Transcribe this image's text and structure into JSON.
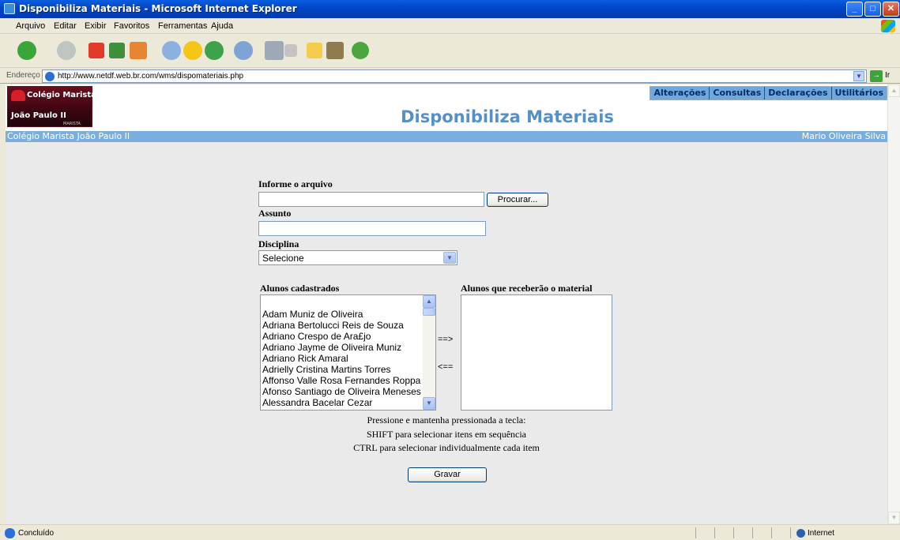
{
  "window": {
    "title": "Disponibiliza Materiais - Microsoft Internet Explorer",
    "minimize": "_",
    "maximize": "□",
    "close": "✕"
  },
  "menu": [
    "Arquivo",
    "Editar",
    "Exibir",
    "Favoritos",
    "Ferramentas",
    "Ajuda"
  ],
  "toolbar_icons": [
    "back-icon",
    "forward-icon",
    "stop-icon",
    "refresh-icon",
    "home-icon",
    "search-icon",
    "favorites-icon",
    "history-icon",
    "mail-icon",
    "print-icon",
    "edit-icon",
    "discuss-icon",
    "research-icon",
    "messenger-icon"
  ],
  "address": {
    "label": "Endereço",
    "url": "http://www.netdf.web.br.com/wms/dispomateriais.php",
    "go_label": "Ir"
  },
  "header": {
    "logo_line1": "Colégio Marista",
    "logo_line2": "João Paulo II",
    "logo_line3": "MARISTA",
    "page_title": "Disponibiliza Materiais",
    "nav": [
      "Alterações",
      "Consultas",
      "Declarações",
      "Utilitários"
    ],
    "school": "Colégio Marista João Paulo II",
    "user": "Mario Oliveira Silva"
  },
  "form": {
    "file_label": "Informe o arquivo",
    "file_value": "",
    "browse_button": "Procurar...",
    "subject_label": "Assunto",
    "subject_value": "",
    "discipline_label": "Disciplina",
    "discipline_selected": "Selecione",
    "students_label": "Alunos cadastrados",
    "recipients_label": "Alunos que receberão o material",
    "add_arrow": "==>",
    "remove_arrow": "<==",
    "students": [
      "Adam Muniz de Oliveira",
      "Adriana Bertolucci Reis de Souza",
      "Adriano Crespo de Ara£jo",
      "Adriano Jayme de Oliveira Muniz",
      "Adriano Rick Amaral",
      "Adrielly Cristina Martins Torres",
      "Affonso Valle Rosa Fernandes Roppa",
      "Afonso Santiago de Oliveira Meneses",
      "Alessandra Bacelar Cezar"
    ],
    "instructions": [
      "Pressione e mantenha pressionada a tecla:",
      "SHIFT para selecionar itens em sequência",
      "CTRL para selecionar individualmente cada item"
    ],
    "save_button": "Gravar"
  },
  "status": {
    "text": "Concluído",
    "zone": "Internet"
  },
  "colors": {
    "title_bar": "#0247c9",
    "page_title": "#5591c8",
    "info_bar": "#7aaedc",
    "nav_bg": "#6ea9de"
  }
}
